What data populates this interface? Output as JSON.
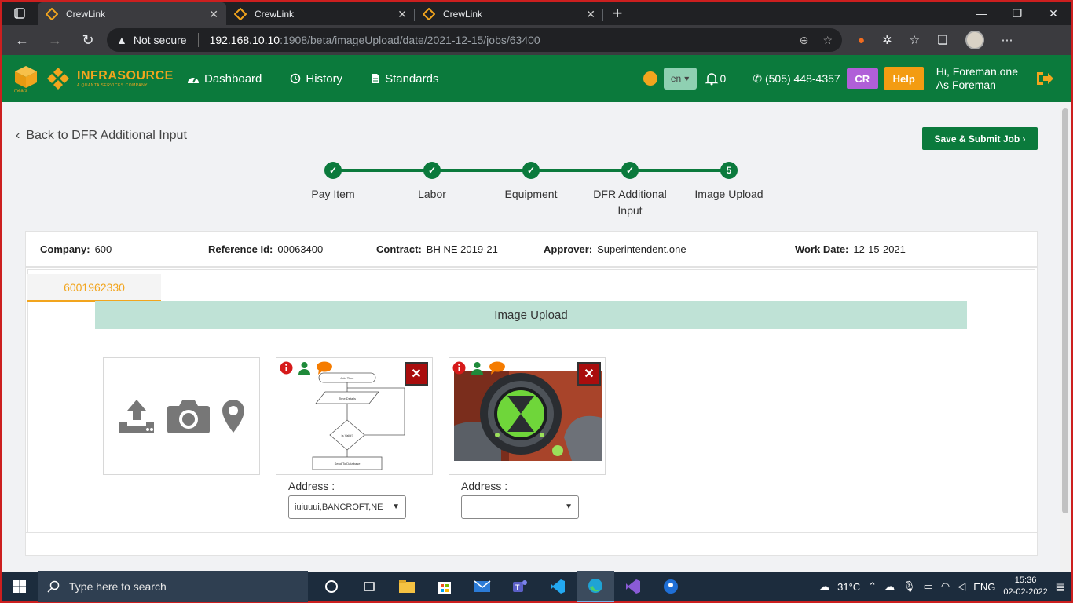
{
  "browser": {
    "tabs": [
      {
        "title": "CrewLink",
        "active": true
      },
      {
        "title": "CrewLink",
        "active": false
      },
      {
        "title": "CrewLink",
        "active": false
      }
    ],
    "security_label": "Not secure",
    "url_host": "192.168.10.10",
    "url_path": ":1908/beta/imageUpload/date/2021-12-15/jobs/63400"
  },
  "header": {
    "logo_text": "INFRASOURCE",
    "logo_sub": "A QUANTA SERVICES COMPANY",
    "logo_mark": "mears",
    "nav": [
      {
        "label": "Dashboard",
        "icon": "dashboard-icon"
      },
      {
        "label": "History",
        "icon": "history-icon"
      },
      {
        "label": "Standards",
        "icon": "document-icon"
      }
    ],
    "language": "en",
    "notification_count": "0",
    "phone": "(505) 448-4357",
    "cr_label": "CR",
    "help_label": "Help",
    "greeting": "Hi, Foreman.one",
    "role": "As Foreman"
  },
  "page": {
    "back_label": "Back to DFR Additional Input",
    "submit_label": "Save & Submit Job",
    "steps": [
      {
        "label": "Pay Item",
        "state": "done"
      },
      {
        "label": "Labor",
        "state": "done"
      },
      {
        "label": "Equipment",
        "state": "done"
      },
      {
        "label": "DFR Additional Input",
        "state": "done"
      },
      {
        "label": "Image Upload",
        "state": "current",
        "number": "5"
      }
    ],
    "info": {
      "company_label": "Company:",
      "company": "600",
      "reference_label": "Reference Id:",
      "reference": "00063400",
      "contract_label": "Contract:",
      "contract": "BH NE 2019-21",
      "approver_label": "Approver:",
      "approver": "Superintendent.one",
      "workdate_label": "Work Date:",
      "workdate": "12-15-2021"
    },
    "job_tab": "6001962330",
    "section_title": "Image Upload",
    "images": [
      {
        "address_label": "Address :",
        "address_value": "iuiuuui,BANCROFT,NE"
      },
      {
        "address_label": "Address :",
        "address_value": ""
      }
    ]
  },
  "flowchart": {
    "start": "Add Time",
    "process": "Time Details",
    "decision": "Is Valid?",
    "end": "Send To Database"
  },
  "taskbar": {
    "search_placeholder": "Type here to search",
    "weather": "31°C",
    "language": "ENG",
    "time": "15:36",
    "date": "02-02-2022"
  },
  "colors": {
    "brand_green": "#0b7a3c",
    "accent_orange": "#f2a51e",
    "upload_header": "#bfe2d6",
    "delete_red": "#a90d0d"
  }
}
